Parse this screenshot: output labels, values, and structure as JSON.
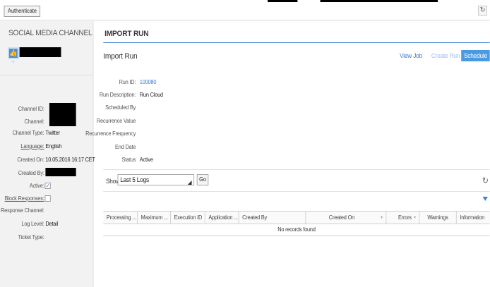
{
  "toolbar": {
    "authenticate_label": "Authenticate",
    "refresh_icon": "refresh-icon"
  },
  "left_panel": {
    "title": "SOCIAL MEDIA CHANNEL",
    "channel_icon": "thumbs-up-icon",
    "fields": {
      "channel_id_label": "Channel ID:",
      "channel_label": "Channel:",
      "channel_type_label": "Channel Type:",
      "channel_type_value": "Twitter",
      "language_label": "Language:",
      "language_value": "English",
      "created_on_label": "Created On:",
      "created_on_value": "10.05.2016 16:17 CET",
      "created_by_label": "Created By:",
      "active_label": "Active:",
      "block_responses_label": "Block Responses:",
      "response_channel_label": "Response Channel:",
      "log_level_label": "Log Level:",
      "log_level_value": "Detail",
      "ticket_type_label": "Ticket Type:"
    },
    "active_checked": true,
    "block_responses_checked": false
  },
  "main": {
    "tab_label": "IMPORT RUN",
    "title": "Import Run",
    "actions": {
      "view_job": "View Job",
      "create_run": "Create Run",
      "schedule": "Schedule"
    },
    "run": {
      "run_id_label": "Run ID:",
      "run_id_value": "100080",
      "run_description_label": "Run Description:",
      "run_description_value": "Run Cloud",
      "scheduled_by_label": "Scheduled By",
      "recurrence_value_label": "Recurrence Value",
      "recurrence_frequency_label": "Recurrence Frequency",
      "end_date_label": "End Date",
      "status_label": "Status",
      "status_value": "Active"
    },
    "logs": {
      "show_label": "Show",
      "selected_option": "Last 5 Logs",
      "go_label": "Go"
    },
    "table": {
      "columns": [
        "Processing ...",
        "Maximum ...",
        "Execution ID",
        "Application ...",
        "Created By",
        "Created On",
        "Errors",
        "Warnings",
        "Information"
      ],
      "empty_text": "No records found"
    }
  },
  "colors": {
    "accent": "#3a86d4",
    "link": "#3a7bd5",
    "schedule_button": "#4a9ae3",
    "left_panel_bg": "#f2f2f2"
  }
}
